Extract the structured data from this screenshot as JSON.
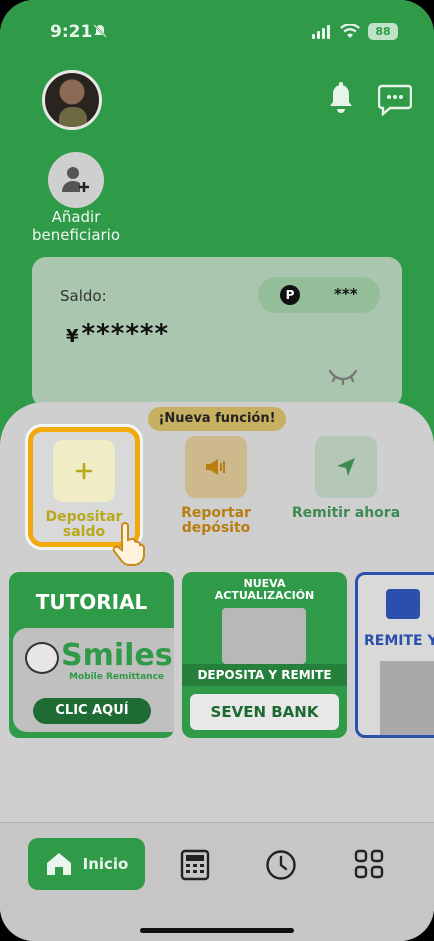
{
  "status_bar": {
    "time": "9:21",
    "battery": "88"
  },
  "header": {
    "avatar": "user-avatar",
    "bell_icon": "bell-icon",
    "chat_icon": "chat-icon"
  },
  "beneficiary": {
    "label": "Añadir beneficiario"
  },
  "balance": {
    "label": "Saldo:",
    "currency": "¥",
    "masked_amount": "******",
    "points_icon": "P",
    "points_value": "***"
  },
  "new_feature_tag": "¡Nueva función!",
  "actions": [
    {
      "label": "Depositar saldo",
      "color": "#b8a81e"
    },
    {
      "label": "Reportar depósito",
      "color": "#b87e12"
    },
    {
      "label": "Remitir ahora",
      "color": "#3e8a50"
    }
  ],
  "banners": {
    "tutorial": {
      "title": "TUTORIAL",
      "brand": "Smiles",
      "subtitle": "Mobile Remittance",
      "cta": "CLIC AQUÍ"
    },
    "seven": {
      "line1": "NUEVA",
      "line2": "ACTUALIZACIÓN",
      "strip": "DEPOSITA Y REMITE",
      "bank": "SEVEN BANK"
    },
    "lawson": {
      "text": "REMITE Y"
    }
  },
  "tabbar": {
    "home_label": "Inicio",
    "items": [
      "calculator-icon",
      "clock-icon",
      "grid-icon"
    ]
  },
  "colors": {
    "brand_green": "#2f9a47",
    "highlight_orange": "#f2a90c"
  }
}
